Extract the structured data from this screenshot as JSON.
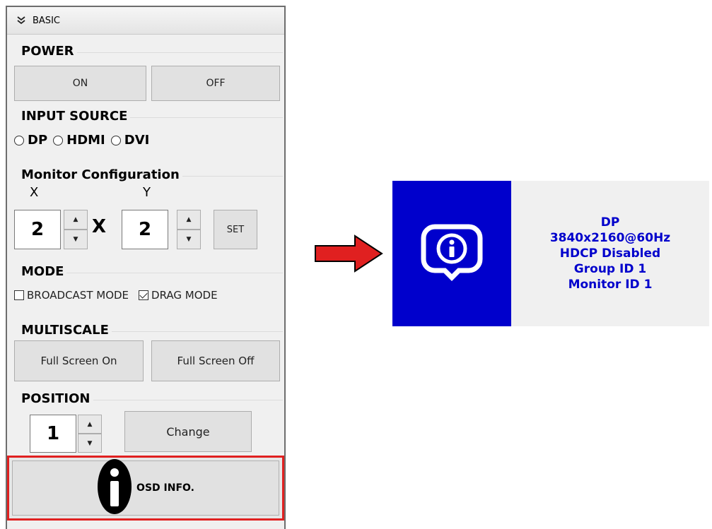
{
  "panel": {
    "header": "BASIC",
    "power": {
      "title": "POWER",
      "on": "ON",
      "off": "OFF"
    },
    "input_source": {
      "title": "INPUT SOURCE",
      "options": [
        "DP",
        "HDMI",
        "DVI"
      ]
    },
    "monitor_config": {
      "title": "Monitor Configuration",
      "x_label": "X",
      "y_label": "Y",
      "x_value": "2",
      "y_value": "2",
      "times": "X",
      "set": "SET"
    },
    "mode": {
      "title": "MODE",
      "broadcast": "BROADCAST MODE",
      "drag": "DRAG MODE"
    },
    "multiscale": {
      "title": "MULTISCALE",
      "on": "Full Screen On",
      "off": "Full Screen Off"
    },
    "position": {
      "title": "POSITION",
      "value": "1",
      "change": "Change"
    },
    "osd_info": "OSD INFO."
  },
  "osd_display": {
    "lines": [
      "DP",
      "3840x2160@60Hz",
      "HDCP Disabled",
      "Group ID 1",
      "Monitor ID 1"
    ]
  },
  "colors": {
    "highlight": "#e02020",
    "osd_blue": "#0000cc",
    "arrow": "#e02020"
  },
  "icons": {
    "header": "chevron-double-down-icon",
    "osd": "info-icon",
    "osd_logo": "monitor-info-logo-icon",
    "arrow": "arrow-right-icon"
  }
}
